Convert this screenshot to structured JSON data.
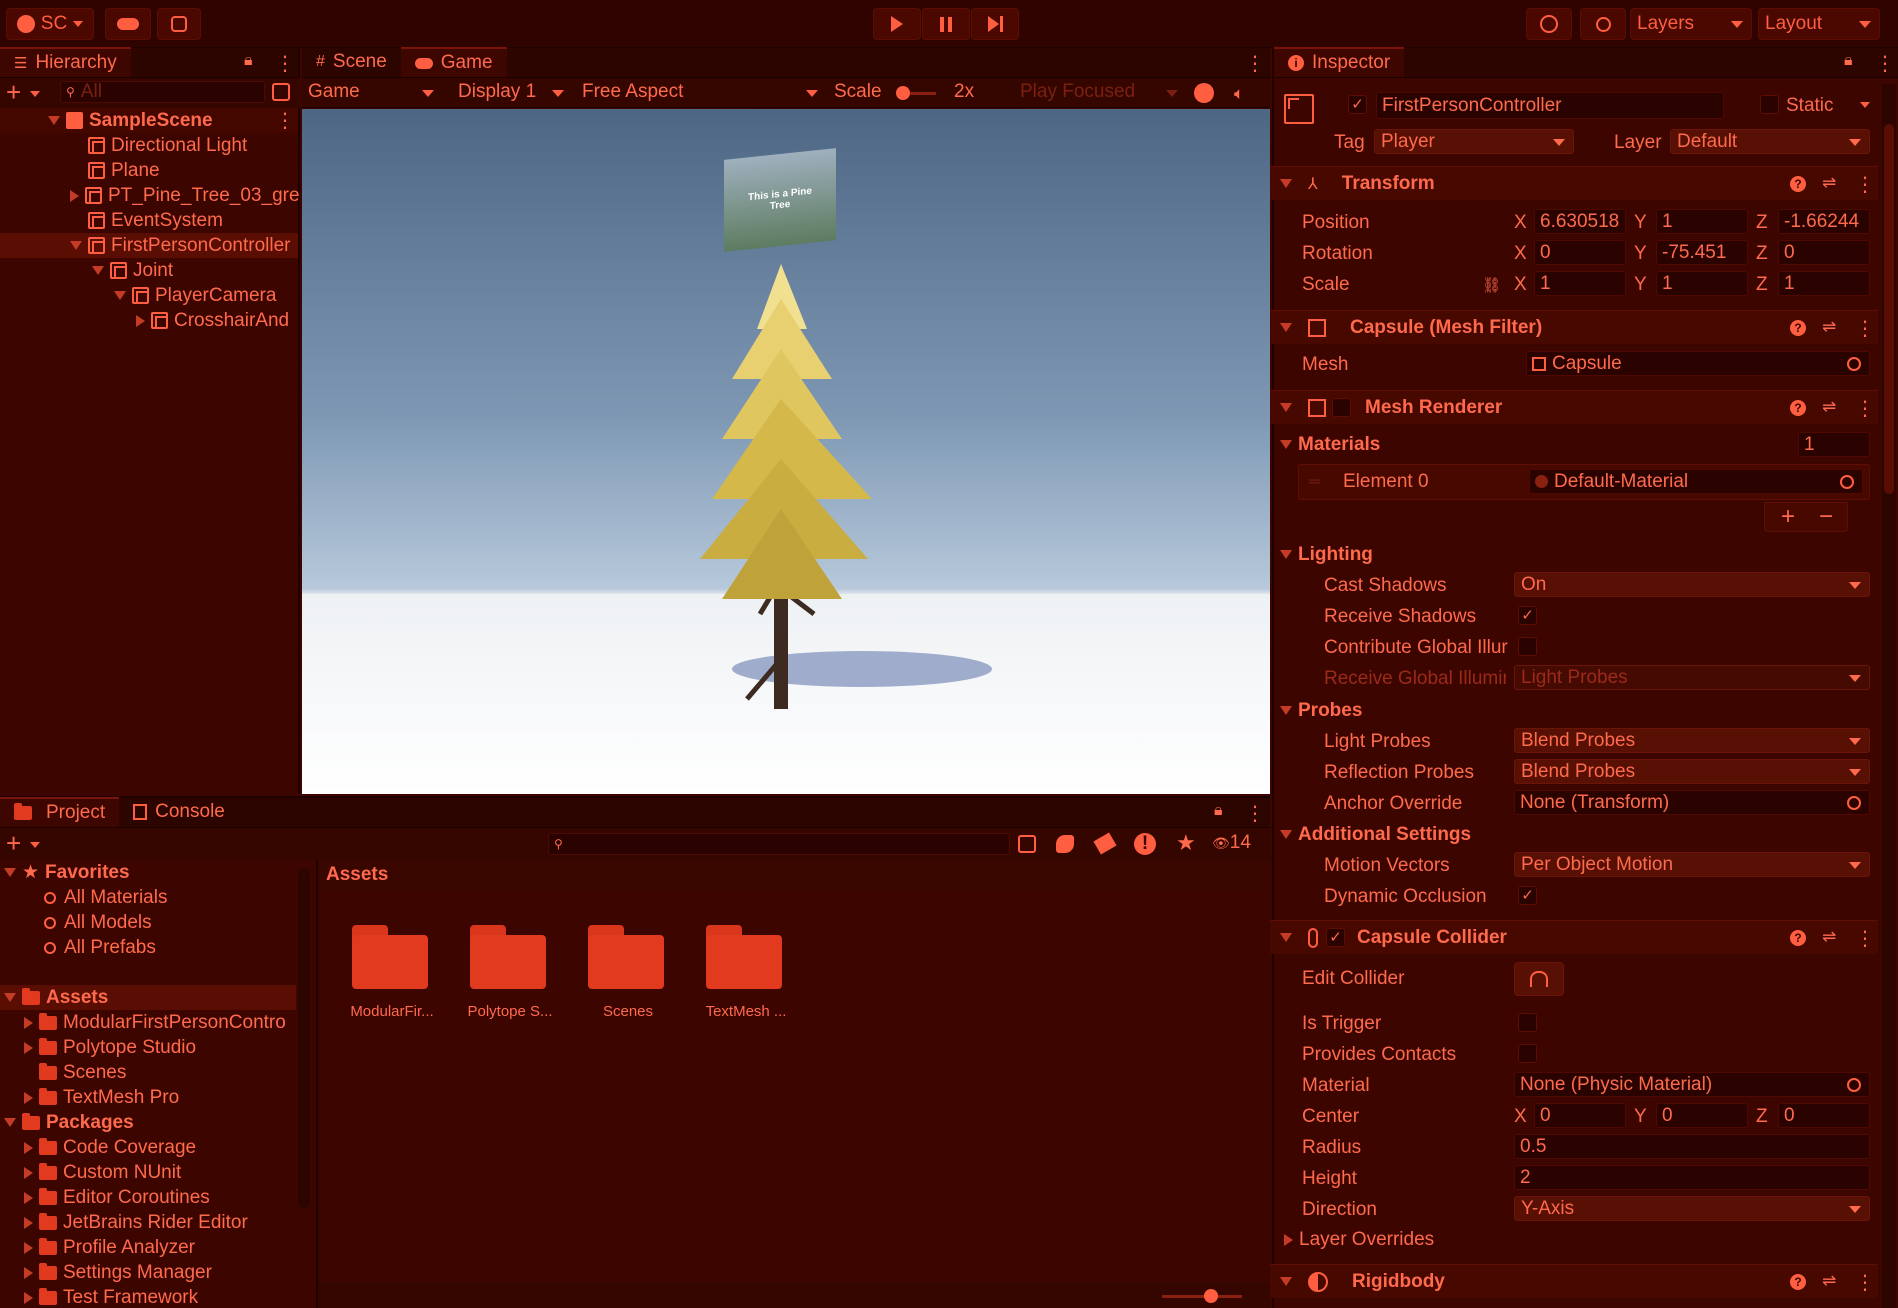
{
  "toolbar": {
    "account": "SC",
    "layers": "Layers",
    "layout": "Layout"
  },
  "hierarchy": {
    "tab": "Hierarchy",
    "search_placeholder": "All",
    "scene": "SampleScene",
    "items": [
      "Directional Light",
      "Plane",
      "PT_Pine_Tree_03_gre",
      "EventSystem",
      "FirstPersonController",
      "Joint",
      "PlayerCamera",
      "CrosshairAnd"
    ]
  },
  "game_view": {
    "tabs": [
      "Scene",
      "Game"
    ],
    "game_dropdown": "Game",
    "display": "Display 1",
    "aspect": "Free Aspect",
    "scale_label": "Scale",
    "scale_value": "2x",
    "play_focused": "Play Focused",
    "sign_text": "This is a Pine Tree"
  },
  "project": {
    "tabs": [
      "Project",
      "Console"
    ],
    "hidden_count": "14",
    "favorites_label": "Favorites",
    "favorites": [
      "All Materials",
      "All Models",
      "All Prefabs"
    ],
    "assets_label": "Assets",
    "assets": [
      "ModularFirstPersonContro",
      "Polytope Studio",
      "Scenes",
      "TextMesh Pro"
    ],
    "packages_label": "Packages",
    "packages": [
      "Code Coverage",
      "Custom NUnit",
      "Editor Coroutines",
      "JetBrains Rider Editor",
      "Profile Analyzer",
      "Settings Manager",
      "Test Framework"
    ],
    "breadcrumb": "Assets",
    "grid": [
      "ModularFir...",
      "Polytope S...",
      "Scenes",
      "TextMesh ..."
    ]
  },
  "inspector": {
    "tab": "Inspector",
    "object_name": "FirstPersonController",
    "static_label": "Static",
    "tag_label": "Tag",
    "tag_value": "Player",
    "layer_label": "Layer",
    "layer_value": "Default",
    "transform": {
      "title": "Transform",
      "position_label": "Position",
      "rotation_label": "Rotation",
      "scale_label": "Scale",
      "position": [
        "6.630518",
        "1",
        "-1.66244"
      ],
      "rotation": [
        "0",
        "-75.451",
        "0"
      ],
      "scale": [
        "1",
        "1",
        "1"
      ]
    },
    "mesh_filter": {
      "title": "Capsule (Mesh Filter)",
      "mesh_label": "Mesh",
      "mesh_value": "Capsule"
    },
    "mesh_renderer": {
      "title": "Mesh Renderer",
      "materials_label": "Materials",
      "materials_count": "1",
      "element0_label": "Element 0",
      "element0_value": "Default-Material",
      "lighting_label": "Lighting",
      "cast_shadows_label": "Cast Shadows",
      "cast_shadows_value": "On",
      "receive_shadows_label": "Receive Shadows",
      "contribute_gi_label": "Contribute Global Illur",
      "receive_gi_label": "Receive Global Illumir",
      "receive_gi_value": "Light Probes",
      "probes_label": "Probes",
      "light_probes_label": "Light Probes",
      "light_probes_value": "Blend Probes",
      "reflection_probes_label": "Reflection Probes",
      "reflection_probes_value": "Blend Probes",
      "anchor_override_label": "Anchor Override",
      "anchor_override_value": "None (Transform)",
      "additional_label": "Additional Settings",
      "motion_vectors_label": "Motion Vectors",
      "motion_vectors_value": "Per Object Motion",
      "dynamic_occlusion_label": "Dynamic Occlusion"
    },
    "capsule_collider": {
      "title": "Capsule Collider",
      "edit_collider_label": "Edit Collider",
      "is_trigger_label": "Is Trigger",
      "provides_contacts_label": "Provides Contacts",
      "material_label": "Material",
      "material_value": "None (Physic Material)",
      "center_label": "Center",
      "center": [
        "0",
        "0",
        "0"
      ],
      "radius_label": "Radius",
      "radius_value": "0.5",
      "height_label": "Height",
      "height_value": "2",
      "direction_label": "Direction",
      "direction_value": "Y-Axis",
      "layer_overrides_label": "Layer Overrides"
    },
    "rigidbody": {
      "title": "Rigidbody"
    }
  },
  "axis": {
    "x": "X",
    "y": "Y",
    "z": "Z"
  },
  "colors": {
    "accent": "#ff6a4d",
    "panel": "#3d0500",
    "header": "#2f0400"
  }
}
